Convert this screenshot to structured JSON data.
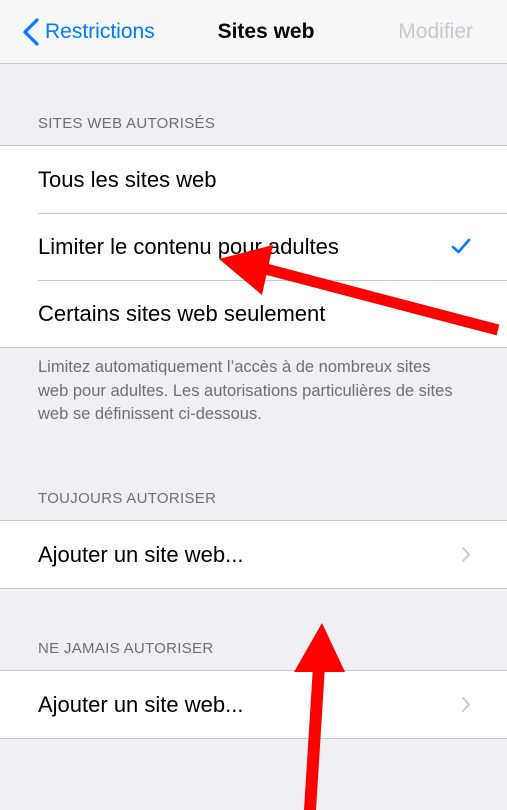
{
  "navbar": {
    "back_label": "Restrictions",
    "title": "Sites web",
    "edit_label": "Modifier"
  },
  "allowed_section": {
    "header": "SITES WEB AUTORISÉS",
    "options": [
      {
        "label": "Tous les sites web",
        "selected": false
      },
      {
        "label": "Limiter le contenu pour adultes",
        "selected": true
      },
      {
        "label": "Certains sites web seulement",
        "selected": false
      }
    ],
    "footer": "Limitez automatiquement l’accès à de nombreux sites web pour adultes. Les autorisations particulières de sites web se définissent ci-dessous."
  },
  "always_allow": {
    "header": "TOUJOURS AUTORISER",
    "add_label": "Ajouter un site web..."
  },
  "never_allow": {
    "header": "NE JAMAIS AUTORISER",
    "add_label": "Ajouter un site web..."
  },
  "colors": {
    "accent": "#007aff",
    "annotation_arrow": "#ff0000",
    "background": "#efeff4"
  }
}
